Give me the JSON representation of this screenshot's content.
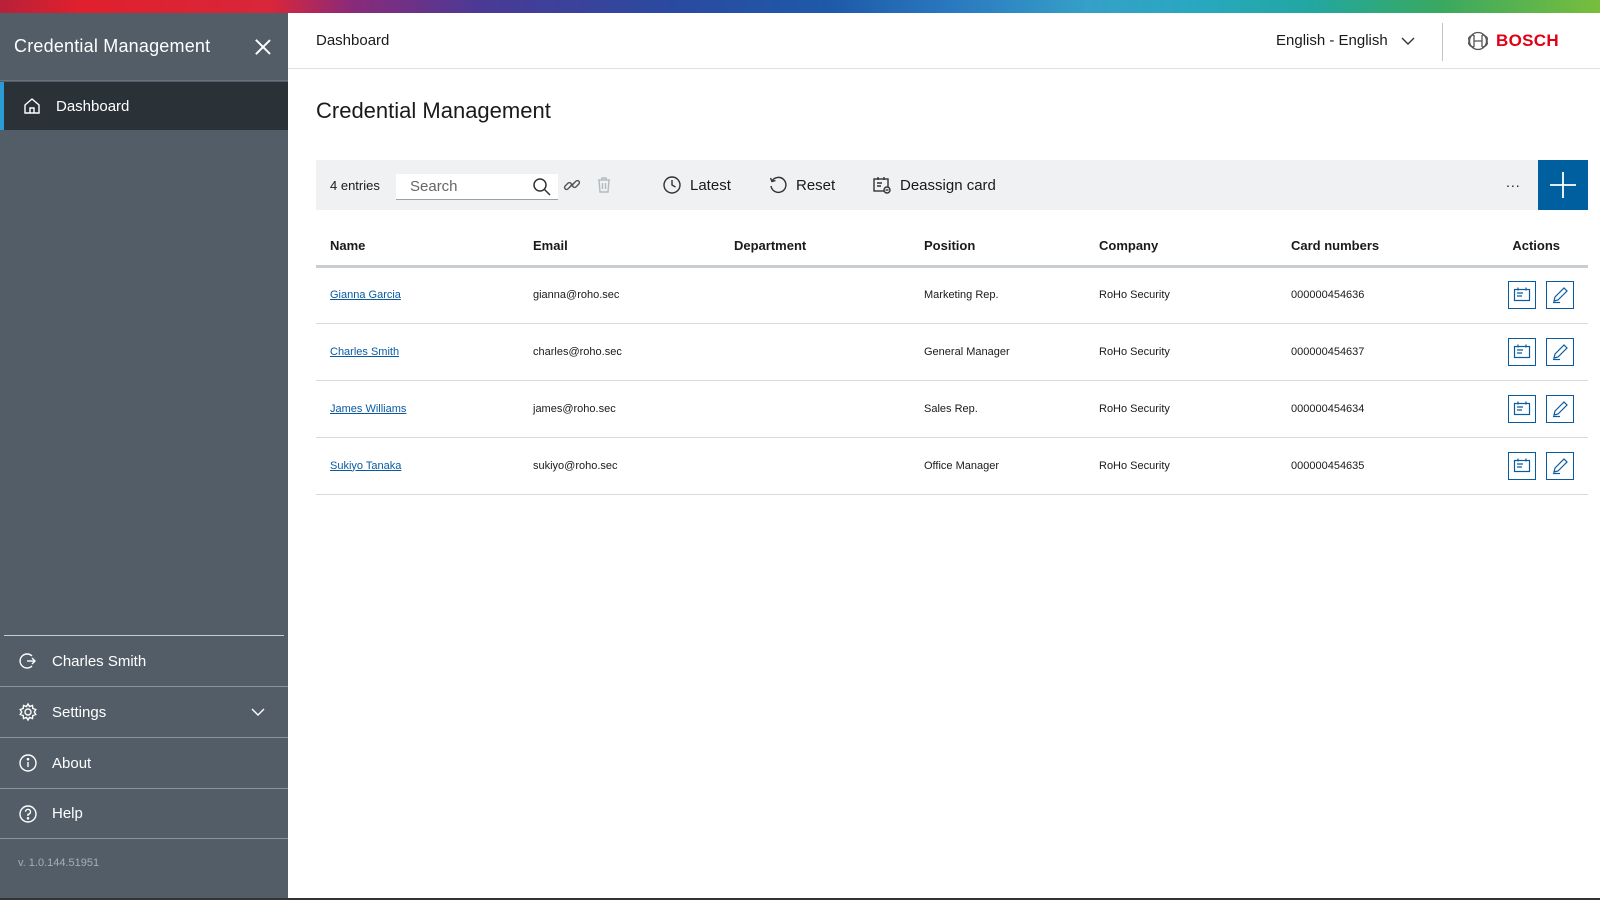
{
  "sidebar": {
    "title": "Credential Management",
    "active_item": {
      "label": "Dashboard",
      "icon": "home-icon"
    },
    "bottom_items": [
      {
        "label": "Charles Smith",
        "icon": "logout-icon"
      },
      {
        "label": "Settings",
        "icon": "gear-icon"
      },
      {
        "label": "About",
        "icon": "info-icon"
      },
      {
        "label": "Help",
        "icon": "help-icon"
      }
    ],
    "version": "v. 1.0.144.51951"
  },
  "topbar": {
    "breadcrumb": "Dashboard",
    "language": "English - English",
    "logo_text": "BOSCH"
  },
  "page": {
    "title": "Credential Management"
  },
  "toolbar": {
    "count": "4 entries",
    "search_placeholder": "Search",
    "latest_label": "Latest",
    "reset_label": "Reset",
    "deassign_label": "Deassign card",
    "more_label": "..."
  },
  "table": {
    "headers": {
      "name": "Name",
      "email": "Email",
      "department": "Department",
      "position": "Position",
      "company": "Company",
      "card_numbers": "Card numbers",
      "actions": "Actions"
    },
    "rows": [
      {
        "name": "Gianna Garcia",
        "email": "gianna@roho.sec",
        "department": "",
        "position": "Marketing Rep.",
        "company": "RoHo Security",
        "card": "000000454636"
      },
      {
        "name": "Charles Smith",
        "email": "charles@roho.sec",
        "department": "",
        "position": "General Manager",
        "company": "RoHo Security",
        "card": "000000454637"
      },
      {
        "name": "James Williams",
        "email": "james@roho.sec",
        "department": "",
        "position": "Sales Rep.",
        "company": "RoHo Security",
        "card": "000000454634"
      },
      {
        "name": "Sukiyo Tanaka",
        "email": "sukiyo@roho.sec",
        "department": "",
        "position": "Office Manager",
        "company": "RoHo Security",
        "card": "000000454635"
      }
    ]
  },
  "colors": {
    "sidebar_bg": "#525d67",
    "sidebar_active_bg": "#2a3137",
    "accent_blue": "#005f9e",
    "link_blue": "#0a5aa0",
    "bosch_red": "#e20015"
  }
}
